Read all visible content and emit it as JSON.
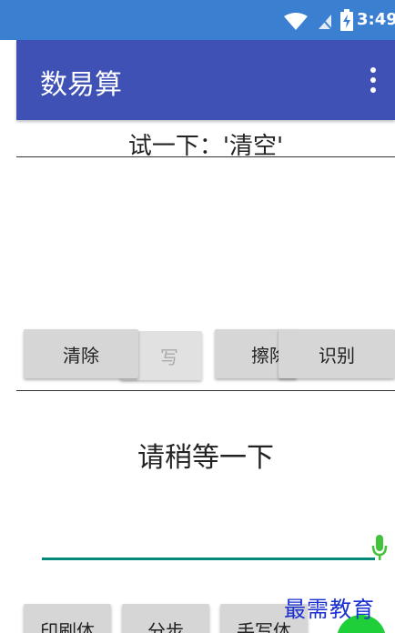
{
  "status_bar": {
    "time": "3:49",
    "wifi_icon": "wifi-icon",
    "sim_icon": "no-sim-icon",
    "battery_icon": "battery-charging-icon",
    "color": "#3b7fd0"
  },
  "app_bar": {
    "title": "数易算",
    "menu_icon": "overflow-menu-icon",
    "color": "#3f51b5"
  },
  "prompt": "试一下：'清空'",
  "canvas_buttons": {
    "clear": "清除",
    "handwrite_partial": "写",
    "erase_partial": "擦除",
    "recognize": "识别"
  },
  "result": "请稍等一下",
  "mic_icon": "microphone-icon",
  "bottom_buttons": {
    "print": "印刷体",
    "step": "分步",
    "handwriting": "手写体"
  },
  "watermark": "最需教育"
}
